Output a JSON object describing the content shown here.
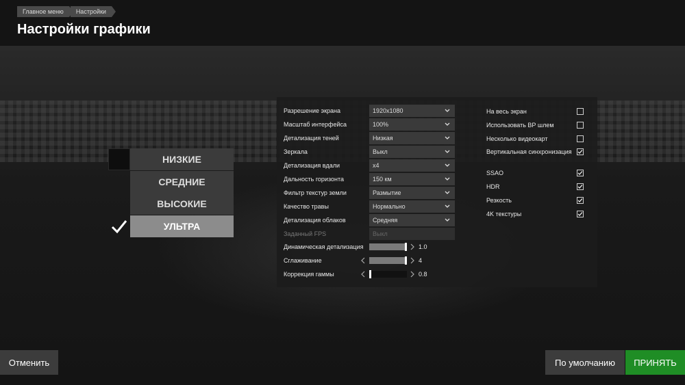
{
  "breadcrumb": [
    "Главное меню",
    "Настройки"
  ],
  "page_title": "Настройки графики",
  "presets": [
    {
      "label": "НИЗКИЕ",
      "active": false
    },
    {
      "label": "СРЕДНИЕ",
      "active": false
    },
    {
      "label": "ВЫСОКИЕ",
      "active": false
    },
    {
      "label": "УЛЬТРА",
      "active": true
    }
  ],
  "settings": [
    {
      "label": "Разрешение экрана",
      "value": "1920x1080",
      "disabled": false
    },
    {
      "label": "Масштаб интерфейса",
      "value": "100%",
      "disabled": false
    },
    {
      "label": "Детализация теней",
      "value": "Низкая",
      "disabled": false
    },
    {
      "label": "Зеркала",
      "value": "Выкл",
      "disabled": false
    },
    {
      "label": "Детализация вдали",
      "value": "x4",
      "disabled": false
    },
    {
      "label": "Дальность горизонта",
      "value": "150 км",
      "disabled": false
    },
    {
      "label": "Фильтр текстур земли",
      "value": "Размытие",
      "disabled": false
    },
    {
      "label": "Качество травы",
      "value": "Нормально",
      "disabled": false
    },
    {
      "label": "Детализация облаков",
      "value": "Средняя",
      "disabled": false
    },
    {
      "label": "Заданный FPS",
      "value": "Выкл",
      "disabled": true
    }
  ],
  "sliders": [
    {
      "label": "Динамическая детализация",
      "value": "1.0",
      "fraction": 1.0
    },
    {
      "label": "Сглаживание",
      "value": "4",
      "fraction": 1.0
    },
    {
      "label": "Коррекция гаммы",
      "value": "0.8",
      "fraction": 0.0
    }
  ],
  "checkboxes": [
    {
      "label": "На весь экран",
      "checked": false
    },
    {
      "label": "Использовать ВР шлем",
      "checked": false
    },
    {
      "label": "Несколько видеокарт",
      "checked": false
    },
    {
      "label": "Вертикальная синхронизация",
      "checked": true
    },
    {
      "label": "SSAO",
      "checked": true
    },
    {
      "label": "HDR",
      "checked": true
    },
    {
      "label": "Резкость",
      "checked": true
    },
    {
      "label": "4K текстуры",
      "checked": true
    }
  ],
  "buttons": {
    "cancel": "Отменить",
    "default": "По умолчанию",
    "accept": "ПРИНЯТЬ"
  },
  "colors": {
    "accent_green": "#1f8d25",
    "active_preset": "#8c8c8c"
  },
  "icons": {
    "check": "check-icon",
    "chevron": "chevron-down-icon",
    "arrow_left": "chevron-left-icon",
    "arrow_right": "chevron-right-icon"
  }
}
